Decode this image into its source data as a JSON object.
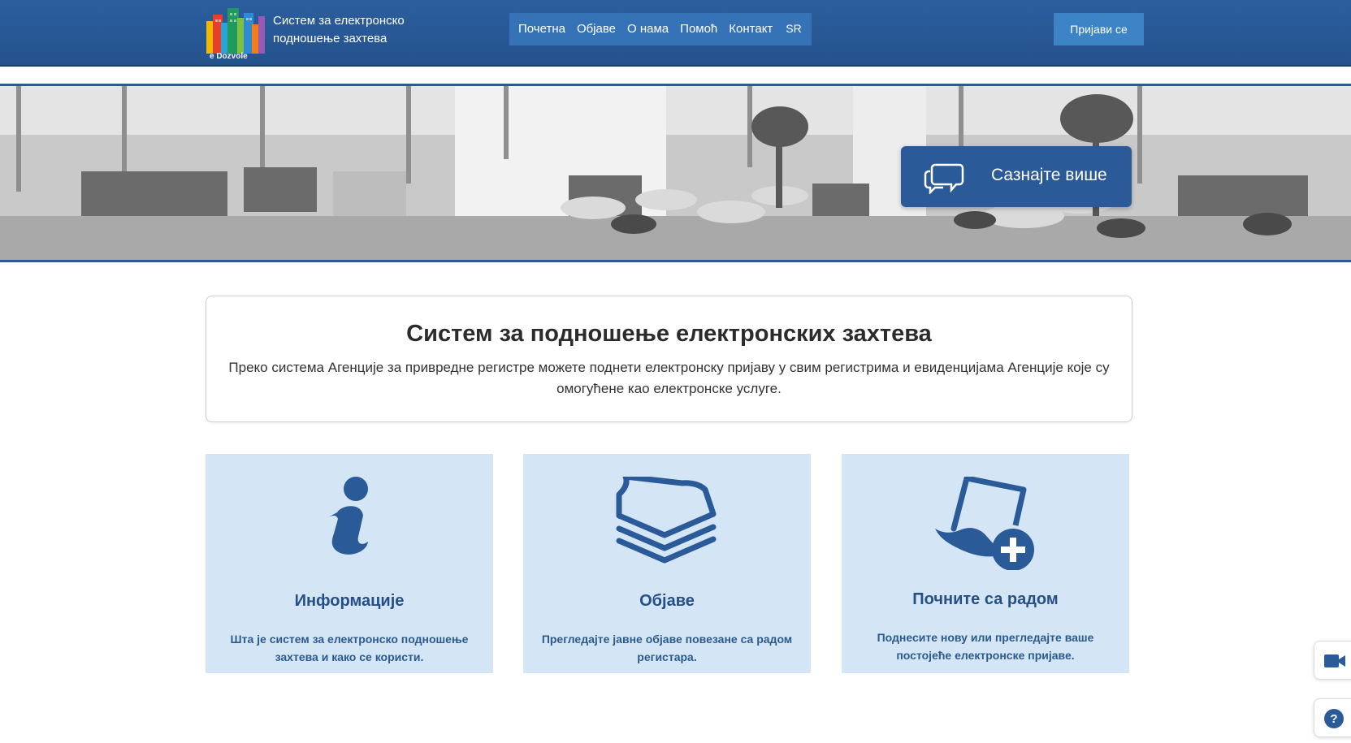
{
  "header": {
    "logo_text": "e Dozvole",
    "title_line1": "Систем за електронско",
    "title_line2": "подношење захтева",
    "nav": [
      {
        "label": "Почетна"
      },
      {
        "label": "Објаве"
      },
      {
        "label": "О нама"
      },
      {
        "label": "Помоћ"
      },
      {
        "label": "Контакт"
      }
    ],
    "language": "SR",
    "login_label": "Пријави се"
  },
  "hero": {
    "cta_label": "Сазнајте више",
    "cta_icon": "chat-bubbles-icon"
  },
  "intro": {
    "title": "Систем за подношење електронских захтева",
    "text": "Преко система Агенције за привредне регистре можете поднети електронску пријаву у свим регистрима и евиденцијама Агенције које су омогућене као електронске услуге."
  },
  "cards": [
    {
      "icon": "info-icon",
      "title": "Информације",
      "text": "Шта је систем за електронско подношење захтева и како се користи."
    },
    {
      "icon": "documents-stack-icon",
      "title": "Објаве",
      "text": "Прегледајте јавне објаве повезане са радом регистара."
    },
    {
      "icon": "new-document-icon",
      "title": "Почните са радом",
      "text": "Поднесите нову или прегледајте ваше постојеће електронске пријаве."
    }
  ],
  "floating": [
    {
      "icon": "video-camera-icon"
    },
    {
      "icon": "help-icon"
    }
  ],
  "colors": {
    "header_bg": "#2c5e9e",
    "nav_bg": "#3572b6",
    "accent": "#2b5a98",
    "card_bg": "#d4e6f5",
    "card_text": "#264f87"
  }
}
